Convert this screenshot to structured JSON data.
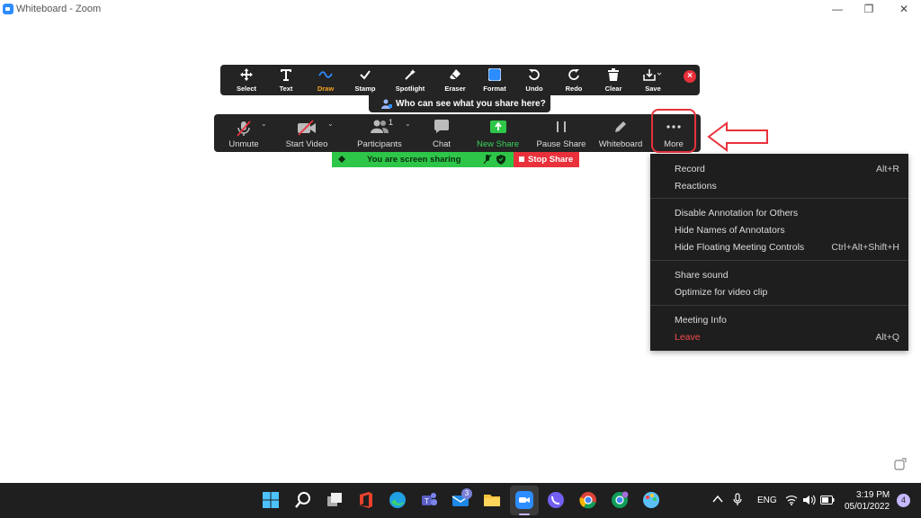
{
  "window": {
    "title": "Whiteboard - Zoom",
    "controls": {
      "minimize": "—",
      "restore": "❐",
      "close": "✕"
    }
  },
  "annotation_toolbar": {
    "tools": [
      {
        "label": "Select",
        "icon": "move-icon"
      },
      {
        "label": "Text",
        "icon": "text-icon"
      },
      {
        "label": "Draw",
        "icon": "draw-wave-icon",
        "active": true
      },
      {
        "label": "Stamp",
        "icon": "checkmark-icon"
      },
      {
        "label": "Spotlight",
        "icon": "spotlight-wand-icon"
      },
      {
        "label": "Eraser",
        "icon": "eraser-icon"
      },
      {
        "label": "Format",
        "icon": "format-color-icon"
      },
      {
        "label": "Undo",
        "icon": "undo-icon"
      },
      {
        "label": "Redo",
        "icon": "redo-icon"
      },
      {
        "label": "Clear",
        "icon": "trash-icon"
      },
      {
        "label": "Save",
        "icon": "save-download-icon"
      }
    ],
    "close_symbol": "×",
    "who_can_see": "Who can see what you share here?"
  },
  "meeting_controls": {
    "items": [
      {
        "label": "Unmute",
        "icon": "muted-mic-icon"
      },
      {
        "label": "Start Video",
        "icon": "video-off-icon"
      },
      {
        "label": "Participants",
        "icon": "participants-icon",
        "count": "1"
      },
      {
        "label": "Chat",
        "icon": "chat-icon"
      },
      {
        "label": "New Share",
        "icon": "share-up-arrow-icon"
      },
      {
        "label": "Pause Share",
        "icon": "pause-icon"
      },
      {
        "label": "Whiteboard",
        "icon": "pencil-icon"
      },
      {
        "label": "More",
        "icon": "ellipsis-icon"
      }
    ],
    "caret": "⌄"
  },
  "sharing": {
    "status": "You are screen sharing",
    "stop_label": "Stop Share"
  },
  "more_menu": {
    "groups": [
      [
        {
          "label": "Record",
          "shortcut": "Alt+R"
        },
        {
          "label": "Reactions",
          "shortcut": ""
        }
      ],
      [
        {
          "label": "Disable Annotation for Others",
          "shortcut": ""
        },
        {
          "label": "Hide Names of Annotators",
          "shortcut": ""
        },
        {
          "label": "Hide Floating Meeting Controls",
          "shortcut": "Ctrl+Alt+Shift+H"
        }
      ],
      [
        {
          "label": "Share sound",
          "shortcut": ""
        },
        {
          "label": "Optimize for video clip",
          "shortcut": ""
        }
      ],
      [
        {
          "label": "Meeting Info",
          "shortcut": ""
        },
        {
          "label": "Leave",
          "shortcut": "Alt+Q"
        }
      ]
    ]
  },
  "taskbar": {
    "apps": [
      "windows-start-icon",
      "search-icon",
      "task-view-icon",
      "office-icon",
      "edge-icon",
      "teams-icon",
      "mail-icon",
      "file-explorer-icon",
      "zoom-icon",
      "viber-icon",
      "chrome-icon",
      "chrome-profile-icon",
      "paint-icon"
    ],
    "teams_badge": "",
    "mail_badge": "3",
    "language": "ENG",
    "time": "3:19 PM",
    "date": "05/01/2022",
    "notifications": "4"
  },
  "colors": {
    "accent_active": "#f5a623",
    "share_green": "#2ec649",
    "stop_red": "#e8313b",
    "leave_red": "#f44b4b",
    "toolbar_bg": "#242424"
  }
}
